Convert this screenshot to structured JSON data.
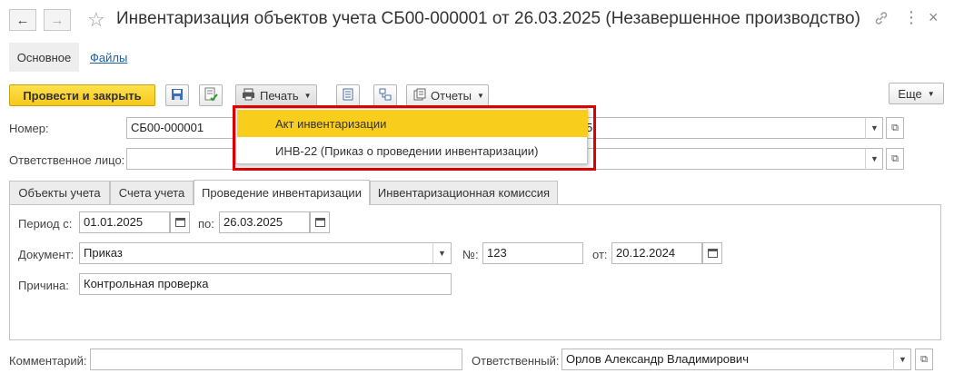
{
  "window": {
    "title": "Инвентаризация объектов учета СБ00-000001 от 26.03.2025 (Незавершенное производство)"
  },
  "icons": {
    "back": "arrow-left-icon",
    "forward": "arrow-right-icon",
    "favorite": "star-icon",
    "link": "link-icon",
    "more": "more-icon",
    "close": "close-icon"
  },
  "sections": {
    "main": "Основное",
    "files": "Файлы"
  },
  "toolbar": {
    "post_close": "Провести и закрыть",
    "print": "Печать",
    "reports": "Отчеты",
    "more": "Еще"
  },
  "print_menu": {
    "items": [
      "Акт инвентаризации",
      "ИНВ-22 (Приказ о проведении инвентаризации)"
    ]
  },
  "header": {
    "number_label": "Номер:",
    "number_value": "СБ00-000001",
    "org_value_tail": "5",
    "responsible_label": "Ответственное лицо:",
    "responsible_value": ""
  },
  "tabs": [
    "Объекты учета",
    "Счета учета",
    "Проведение инвентаризации",
    "Инвентаризационная комиссия"
  ],
  "conduct": {
    "period_from_label": "Период с:",
    "period_from": "01.01.2025",
    "period_to_label": "по:",
    "period_to": "26.03.2025",
    "document_label": "Документ:",
    "document_value": "Приказ",
    "doc_number_label": "№:",
    "doc_number": "123",
    "doc_date_label": "от:",
    "doc_date": "20.12.2024",
    "reason_label": "Причина:",
    "reason_value": "Контрольная проверка"
  },
  "footer": {
    "comment_label": "Комментарий:",
    "comment_value": "",
    "responsible_label": "Ответственный:",
    "responsible_value": "Орлов Александр Владимирович"
  },
  "colors": {
    "primary_button": "#f7c81a",
    "popup_selected": "#f9cd1b",
    "highlight_outline": "#e00000",
    "link": "#1c5ea7"
  }
}
